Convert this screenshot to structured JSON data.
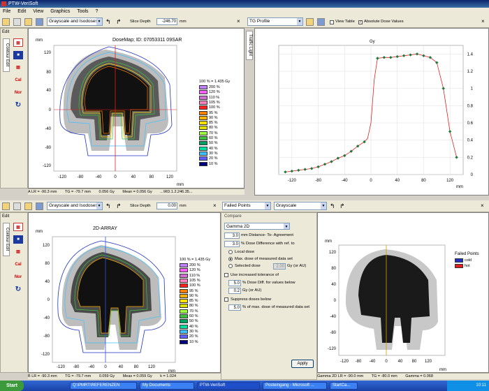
{
  "window": {
    "title": "PTW-VeriSoft"
  },
  "menu": [
    "File",
    "Edit",
    "View",
    "Graphics",
    "Tools",
    "?"
  ],
  "top_left": {
    "display_mode": "Grayscale and Isodoses",
    "slice_depth_label": "Slice Depth",
    "slice_depth_value": "-246.70",
    "slice_depth_unit": "mm",
    "edit_tab": "Edit",
    "side_tabs": [
      "Contour Edit"
    ],
    "plot_title": "DoseMap; ID: 07053311 09SAR",
    "y_unit": "mm",
    "x_unit": "mm",
    "y_ticks": [
      "120",
      "80",
      "40",
      "0",
      "-40",
      "-80",
      "-120"
    ],
    "x_ticks": [
      "-120",
      "-80",
      "-40",
      "0",
      "40",
      "80",
      "120"
    ],
    "status": {
      "a": "A  LR = -90.3 mm",
      "tg": "TG = -79.7 mm",
      "gy": "0.056 Gy",
      "mean": "Mean = 0.056 Gy",
      "file": "...\\RD.1.2.246.35..."
    }
  },
  "top_right": {
    "profile_mode": "TG Profile",
    "view_table_label": "View Table",
    "abs_dose_label": "Absolute Dose Values",
    "side_tab": "Traffic Light",
    "y_unit": "Gy",
    "x_unit": "mm",
    "y_ticks": [
      "1.4",
      "1.2",
      "1",
      "0.8",
      "0.6",
      "0.4",
      "0.2",
      "0"
    ],
    "x_ticks": [
      "-120",
      "-80",
      "-40",
      "0",
      "40",
      "80",
      "120"
    ]
  },
  "legend": {
    "header": "100 % = 1.435 Gy",
    "items": [
      {
        "label": "200 %",
        "color": "#c080ff"
      },
      {
        "label": "120 %",
        "color": "#ff60ff"
      },
      {
        "label": "110 %",
        "color": "#d070d0"
      },
      {
        "label": "105 %",
        "color": "#ff80c0"
      },
      {
        "label": "100 %",
        "color": "#ff2020"
      },
      {
        "label": "95 %",
        "color": "#ff8000"
      },
      {
        "label": "90 %",
        "color": "#ffb000"
      },
      {
        "label": "85 %",
        "color": "#ffe000"
      },
      {
        "label": "80 %",
        "color": "#e0e000"
      },
      {
        "label": "70 %",
        "color": "#a0ff40"
      },
      {
        "label": "60 %",
        "color": "#40c040"
      },
      {
        "label": "50 %",
        "color": "#00a060"
      },
      {
        "label": "40 %",
        "color": "#00e0a0"
      },
      {
        "label": "30 %",
        "color": "#40c0ff"
      },
      {
        "label": "20 %",
        "color": "#6060ff"
      },
      {
        "label": "10 %",
        "color": "#000080"
      }
    ]
  },
  "bottom_left": {
    "display_mode": "Grayscale and Isodoses",
    "slice_depth_label": "Slice Depth",
    "slice_depth_value": "0.00",
    "slice_depth_unit": "mm",
    "edit_tab": "Edit",
    "side_tabs": [
      "Contour Edit"
    ],
    "plot_title": "2D-ARRAY",
    "y_unit": "mm",
    "x_unit": "mm",
    "status": {
      "a": "B  LR = -90.3 mm",
      "tg": "TG = -79.7 mm",
      "gy": "0.059 Gy",
      "mean": "Meas = 0.059 Gy",
      "k": "k = 1.024"
    }
  },
  "bottom_right": {
    "failed_mode": "Failed Points",
    "display_mode": "Grayscale",
    "compare_header": "Compare",
    "gamma_select": "Gamma 2D",
    "dta_value": "3.0",
    "dta_label": "mm Distance- To- Agreement",
    "dd_value": "3.0",
    "dd_label": "% Dose Difference with ref. to",
    "local_dose": "Local dose",
    "max_dose": "Max. dose of measured data set",
    "selected_dose": "Selected dose",
    "selected_dose_value": "2.00",
    "selected_dose_unit": "Gy (or AU)",
    "increased_tol": "Use increased tolerance of",
    "tol_value": "5.0",
    "tol_label": "% Dose Diff. for values below",
    "below_value": "0.2",
    "below_unit": "Gy (or AU)",
    "suppress": "Suppress doses below",
    "suppress_value": "5.0",
    "suppress_label": "% of max. dose of measured data set",
    "apply": "Apply",
    "fp_title": "Failed Points",
    "fp_cold": "cold",
    "fp_hot": "hot",
    "y_unit": "mm",
    "x_unit": "mm",
    "status": {
      "a": "Gamma 2D  LR = -90.0 mm",
      "tg": "TG = -80.0 mm",
      "g": "Gamma = 0.068"
    }
  },
  "taskbar": {
    "start": "Start",
    "tasks": [
      "Q:\\PMRT\\REFERENZEN",
      "My Documents",
      "PTW-VeriSoft",
      "Posteingang - Microsoft ...",
      "StartCa..."
    ],
    "clock": "10:11"
  },
  "tg_profile": {
    "type": "line",
    "x": [
      -130,
      -120,
      -110,
      -100,
      -90,
      -80,
      -70,
      -60,
      -50,
      -40,
      -30,
      -20,
      -10,
      -5,
      0,
      5,
      10,
      20,
      30,
      40,
      50,
      60,
      70,
      80,
      90,
      100,
      110,
      120,
      125,
      130
    ],
    "y": [
      0.03,
      0.04,
      0.05,
      0.06,
      0.07,
      0.09,
      0.12,
      0.15,
      0.19,
      0.22,
      0.27,
      0.33,
      0.38,
      0.42,
      0.6,
      1.1,
      1.35,
      1.36,
      1.36,
      1.37,
      1.38,
      1.39,
      1.4,
      1.38,
      1.36,
      1.3,
      1.0,
      0.5,
      0.35,
      0.2
    ],
    "points_x": [
      -130,
      -120,
      -110,
      -100,
      -90,
      -80,
      -70,
      -60,
      -50,
      -40,
      -30,
      -20,
      -10,
      10,
      20,
      30,
      40,
      50,
      60,
      70,
      80,
      90,
      100,
      110,
      120,
      130
    ],
    "points_y": [
      0.03,
      0.04,
      0.05,
      0.06,
      0.07,
      0.09,
      0.12,
      0.15,
      0.19,
      0.22,
      0.27,
      0.33,
      0.38,
      1.35,
      1.36,
      1.36,
      1.37,
      1.38,
      1.39,
      1.4,
      1.38,
      1.36,
      1.3,
      1.0,
      0.5,
      0.2
    ],
    "xlim": [
      -140,
      140
    ],
    "ylim": [
      0,
      1.5
    ],
    "title": "",
    "xlabel": "mm",
    "ylabel": "Gy"
  }
}
